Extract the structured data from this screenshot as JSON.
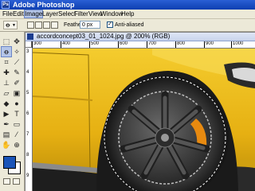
{
  "app": {
    "title": "Adobe Photoshop",
    "icon": "photoshop-icon"
  },
  "menu": [
    "File",
    "Edit",
    "Image",
    "Layer",
    "Select",
    "Filter",
    "View",
    "Window",
    "Help"
  ],
  "menu_active": "Image",
  "options": {
    "feather_label": "Feather:",
    "feather_value": "0 px",
    "antialias_label": "Anti-aliased",
    "antialias_checked": true
  },
  "document": {
    "title": "accordconcept03_01_1024.jpg @ 200% (RGB)"
  },
  "ruler": {
    "h_labels": [
      "300",
      "400",
      "500",
      "600",
      "700",
      "800",
      "900",
      "1000"
    ],
    "v_labels": [
      "3",
      "4",
      "5",
      "6",
      "7",
      "8",
      "9"
    ]
  },
  "colors": {
    "foreground": "#1a54b8",
    "background": "#ffffff",
    "car_body": "#e8b514"
  }
}
